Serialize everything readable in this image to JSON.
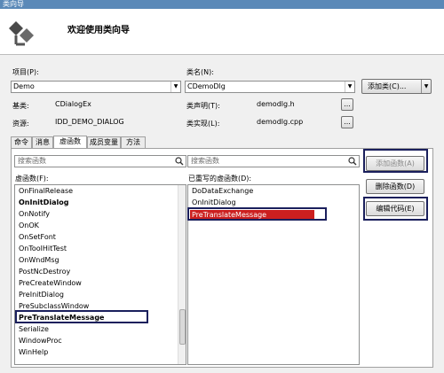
{
  "window": {
    "title": "类向导"
  },
  "header": {
    "title": "欢迎使用类向导"
  },
  "form": {
    "project_label": "项目(P):",
    "project_value": "Demo",
    "classname_label": "类名(N):",
    "classname_value": "CDemoDlg",
    "add_class_label": "添加类(C)...",
    "base_label": "基类:",
    "base_value": "CDialogEx",
    "decl_label": "类声明(T):",
    "decl_value": "demodlg.h",
    "resource_label": "资源:",
    "resource_value": "IDD_DEMO_DIALOG",
    "impl_label": "类实现(L):",
    "impl_value": "demodlg.cpp"
  },
  "tabs": [
    "命令",
    "消息",
    "虚函数",
    "成员变量",
    "方法"
  ],
  "active_tab": "虚函数",
  "panel": {
    "search_placeholder_left": "搜索函数",
    "search_placeholder_right": "搜索函数",
    "left_list_label": "虚函数(F):",
    "right_list_label": "已重写的虚函数(D):",
    "left_items": [
      "OnFinalRelease",
      "OnInitDialog",
      "OnNotify",
      "OnOK",
      "OnSetFont",
      "OnToolHitTest",
      "OnWndMsg",
      "PostNcDestroy",
      "PreCreateWindow",
      "PreInitDialog",
      "PreSubclassWindow",
      "PreTranslateMessage",
      "Serialize",
      "WindowProc",
      "WinHelp"
    ],
    "right_items": [
      "DoDataExchange",
      "OnInitDialog",
      "PreTranslateMessage"
    ],
    "add_function_label": "添加函数(A)",
    "delete_function_label": "删除函数(D)",
    "edit_code_label": "编辑代码(E)"
  },
  "colors": {
    "selection": "#cc1f1f",
    "highlight_box": "#1a1f5c",
    "titlebar": "#5a89b8"
  }
}
